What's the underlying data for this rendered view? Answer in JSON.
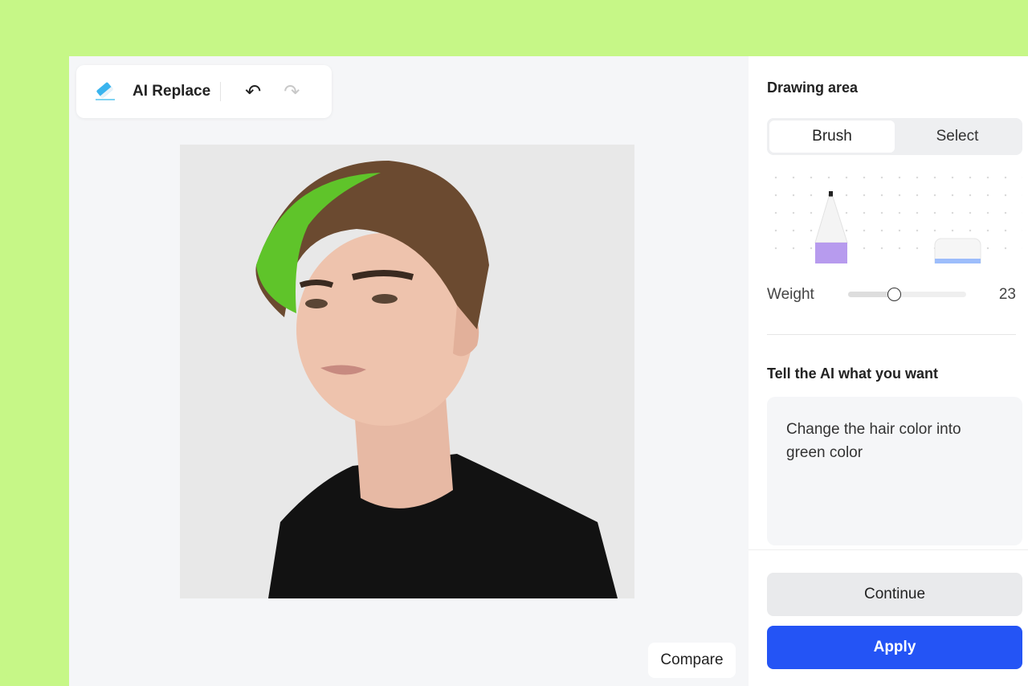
{
  "toolbar": {
    "title": "AI Replace",
    "icons": [
      "eraser-icon",
      "undo-icon",
      "redo-icon"
    ]
  },
  "canvas": {
    "compare_label": "Compare"
  },
  "panel": {
    "drawing_area_title": "Drawing area",
    "tabs": [
      {
        "label": "Brush",
        "active": true
      },
      {
        "label": "Select",
        "active": false
      }
    ],
    "weight_label": "Weight",
    "weight_value": 23,
    "weight_fraction": 0.39,
    "prompt_title": "Tell the AI what you want",
    "prompt_text": "Change the hair color into green color",
    "continue_label": "Continue",
    "apply_label": "Apply"
  },
  "colors": {
    "accent": "#2454f5",
    "frame": "#c6f787"
  }
}
